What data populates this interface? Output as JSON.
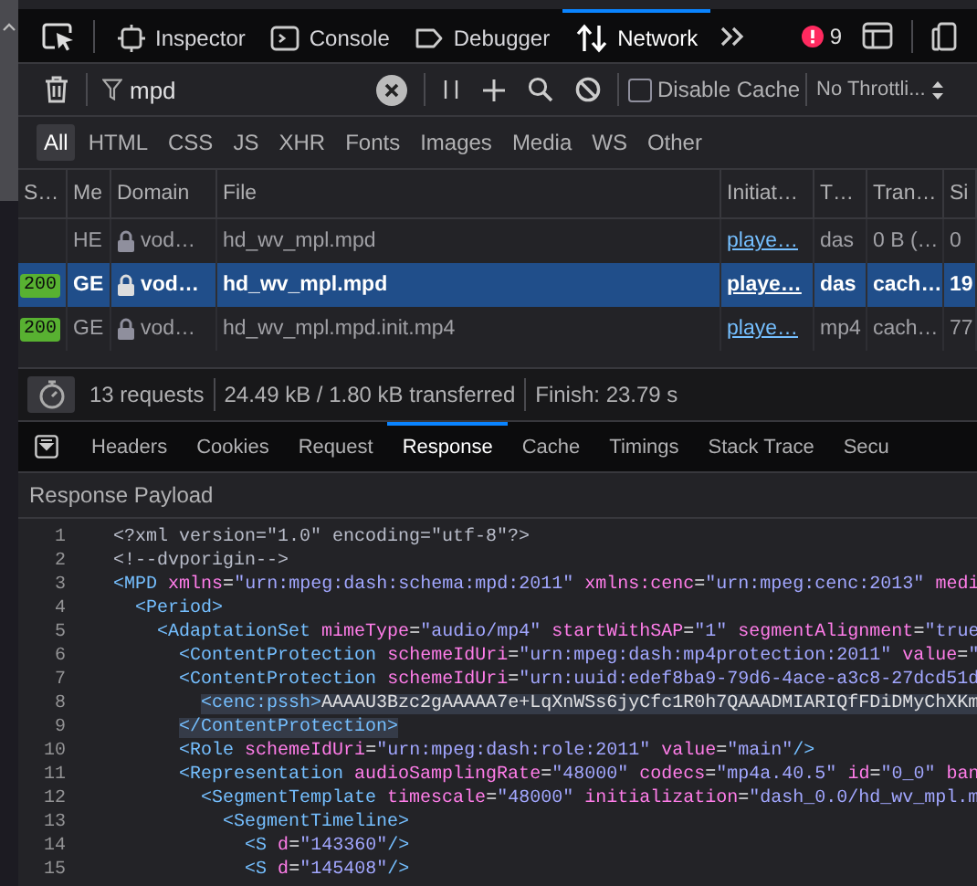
{
  "toolbar": {
    "tabs": [
      {
        "label": "Inspector",
        "selected": false
      },
      {
        "label": "Console",
        "selected": false
      },
      {
        "label": "Debugger",
        "selected": false
      },
      {
        "label": "Network",
        "selected": true
      }
    ],
    "error_count": "9"
  },
  "filter_bar": {
    "filter": {
      "value": "mpd"
    },
    "disable_cache": {
      "label": "Disable Cache",
      "checked": false
    },
    "throttling": "No Throttli..."
  },
  "type_filters": [
    {
      "label": "All",
      "selected": true
    },
    {
      "label": "HTML",
      "selected": false
    },
    {
      "label": "CSS",
      "selected": false
    },
    {
      "label": "JS",
      "selected": false
    },
    {
      "label": "XHR",
      "selected": false
    },
    {
      "label": "Fonts",
      "selected": false
    },
    {
      "label": "Images",
      "selected": false
    },
    {
      "label": "Media",
      "selected": false
    },
    {
      "label": "WS",
      "selected": false
    },
    {
      "label": "Other",
      "selected": false
    }
  ],
  "table": {
    "columns": [
      "S…",
      "Me",
      "Domain",
      "File",
      "Initiat…",
      "T…",
      "Tran…",
      "Si"
    ],
    "rows": [
      {
        "selected": false,
        "method": "HE",
        "domain": "vod…",
        "file": "hd_wv_mpl.mpd",
        "initiator": "playe…",
        "type": "das",
        "transferred": "0 B (…",
        "size": "0"
      },
      {
        "selected": true,
        "status": "200",
        "method": "GE",
        "domain": "vod…",
        "file": "hd_wv_mpl.mpd",
        "initiator": "playe…",
        "type": "das",
        "transferred": "cach…",
        "size": "19"
      },
      {
        "selected": false,
        "status": "200",
        "method": "GE",
        "domain": "vod…",
        "file": "hd_wv_mpl.mpd.init.mp4",
        "initiator": "playe…",
        "type": "mp4",
        "transferred": "cach…",
        "size": "77"
      }
    ]
  },
  "status_bar": {
    "requests": "13 requests",
    "transferred": "24.49 kB / 1.80 kB transferred",
    "finish": "Finish: 23.79 s"
  },
  "detail_tabs": [
    {
      "label": "Headers",
      "selected": false
    },
    {
      "label": "Cookies",
      "selected": false
    },
    {
      "label": "Request",
      "selected": false
    },
    {
      "label": "Response",
      "selected": true
    },
    {
      "label": "Cache",
      "selected": false
    },
    {
      "label": "Timings",
      "selected": false
    },
    {
      "label": "Stack Trace",
      "selected": false
    },
    {
      "label": "Secu",
      "selected": false
    }
  ],
  "payload": {
    "title": "Response Payload",
    "lines": [
      {
        "number": "1",
        "selected": false,
        "text": "<?xml version=\"1.0\" encoding=\"utf-8\"?>"
      },
      {
        "number": "2",
        "selected": false,
        "text": "<!--dvporigin-->"
      },
      {
        "number": "3",
        "selected": false,
        "text": "<MPD xmlns=\"urn:mpeg:dash:schema:mpd:2011\" xmlns:cenc=\"urn:mpeg:cenc:2013\" medi"
      },
      {
        "number": "4",
        "selected": false,
        "text": "  <Period>"
      },
      {
        "number": "5",
        "selected": false,
        "text": "    <AdaptationSet mimeType=\"audio/mp4\" startWithSAP=\"1\" segmentAlignment=\"true"
      },
      {
        "number": "6",
        "selected": false,
        "text": "      <ContentProtection schemeIdUri=\"urn:mpeg:dash:mp4protection:2011\" value=\""
      },
      {
        "number": "7",
        "selected": false,
        "text": "      <ContentProtection schemeIdUri=\"urn:uuid:edef8ba9-79d6-4ace-a3c8-27dcd51d"
      },
      {
        "number": "8",
        "selected": true,
        "text": "        <cenc:pssh>AAAAU3Bzc2gAAAAA7e+LqXnWSs6jyCfc1R0h7QAAADMIARIQfFDiDMyChXKm"
      },
      {
        "number": "9",
        "selected": true,
        "text": "      </ContentProtection>"
      },
      {
        "number": "10",
        "selected": false,
        "text": "      <Role schemeIdUri=\"urn:mpeg:dash:role:2011\" value=\"main\"/>"
      },
      {
        "number": "11",
        "selected": false,
        "text": "      <Representation audioSamplingRate=\"48000\" codecs=\"mp4a.40.5\" id=\"0_0\" ban"
      },
      {
        "number": "12",
        "selected": false,
        "text": "        <SegmentTemplate timescale=\"48000\" initialization=\"dash_0.0/hd_wv_mpl.m"
      },
      {
        "number": "13",
        "selected": false,
        "text": "          <SegmentTimeline>"
      },
      {
        "number": "14",
        "selected": false,
        "text": "            <S d=\"143360\"/>"
      },
      {
        "number": "15",
        "selected": false,
        "text": "            <S d=\"145408\"/>"
      }
    ]
  }
}
